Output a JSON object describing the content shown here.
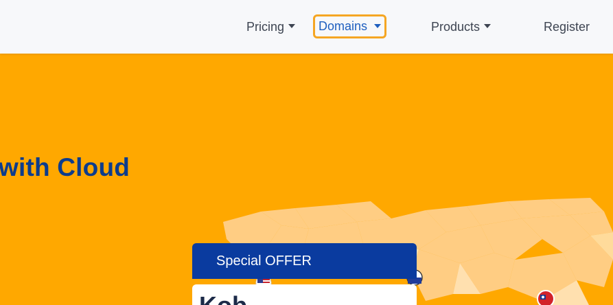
{
  "nav": {
    "items": [
      {
        "label": "Pricing",
        "has_dropdown": true
      },
      {
        "label": "Domains",
        "has_dropdown": true,
        "focused": true
      },
      {
        "label": "Products",
        "has_dropdown": true
      },
      {
        "label": "Register",
        "has_dropdown": false
      }
    ]
  },
  "hero": {
    "title": "with Cloud"
  },
  "offer": {
    "label": "Special OFFER",
    "brand": "Kob"
  },
  "colors": {
    "hero_bg": "#FFA800",
    "nav_bg": "#F7F8FA",
    "title": "#0D3C8C",
    "offer_header": "#0A3B9F",
    "focus_ring": "#F5A623",
    "link": "#1F5FBF"
  },
  "icons": [
    "caret-down-icon",
    "us-flag-icon",
    "flag-icon",
    "taiwan-flag-icon",
    "world-map-graphic"
  ]
}
